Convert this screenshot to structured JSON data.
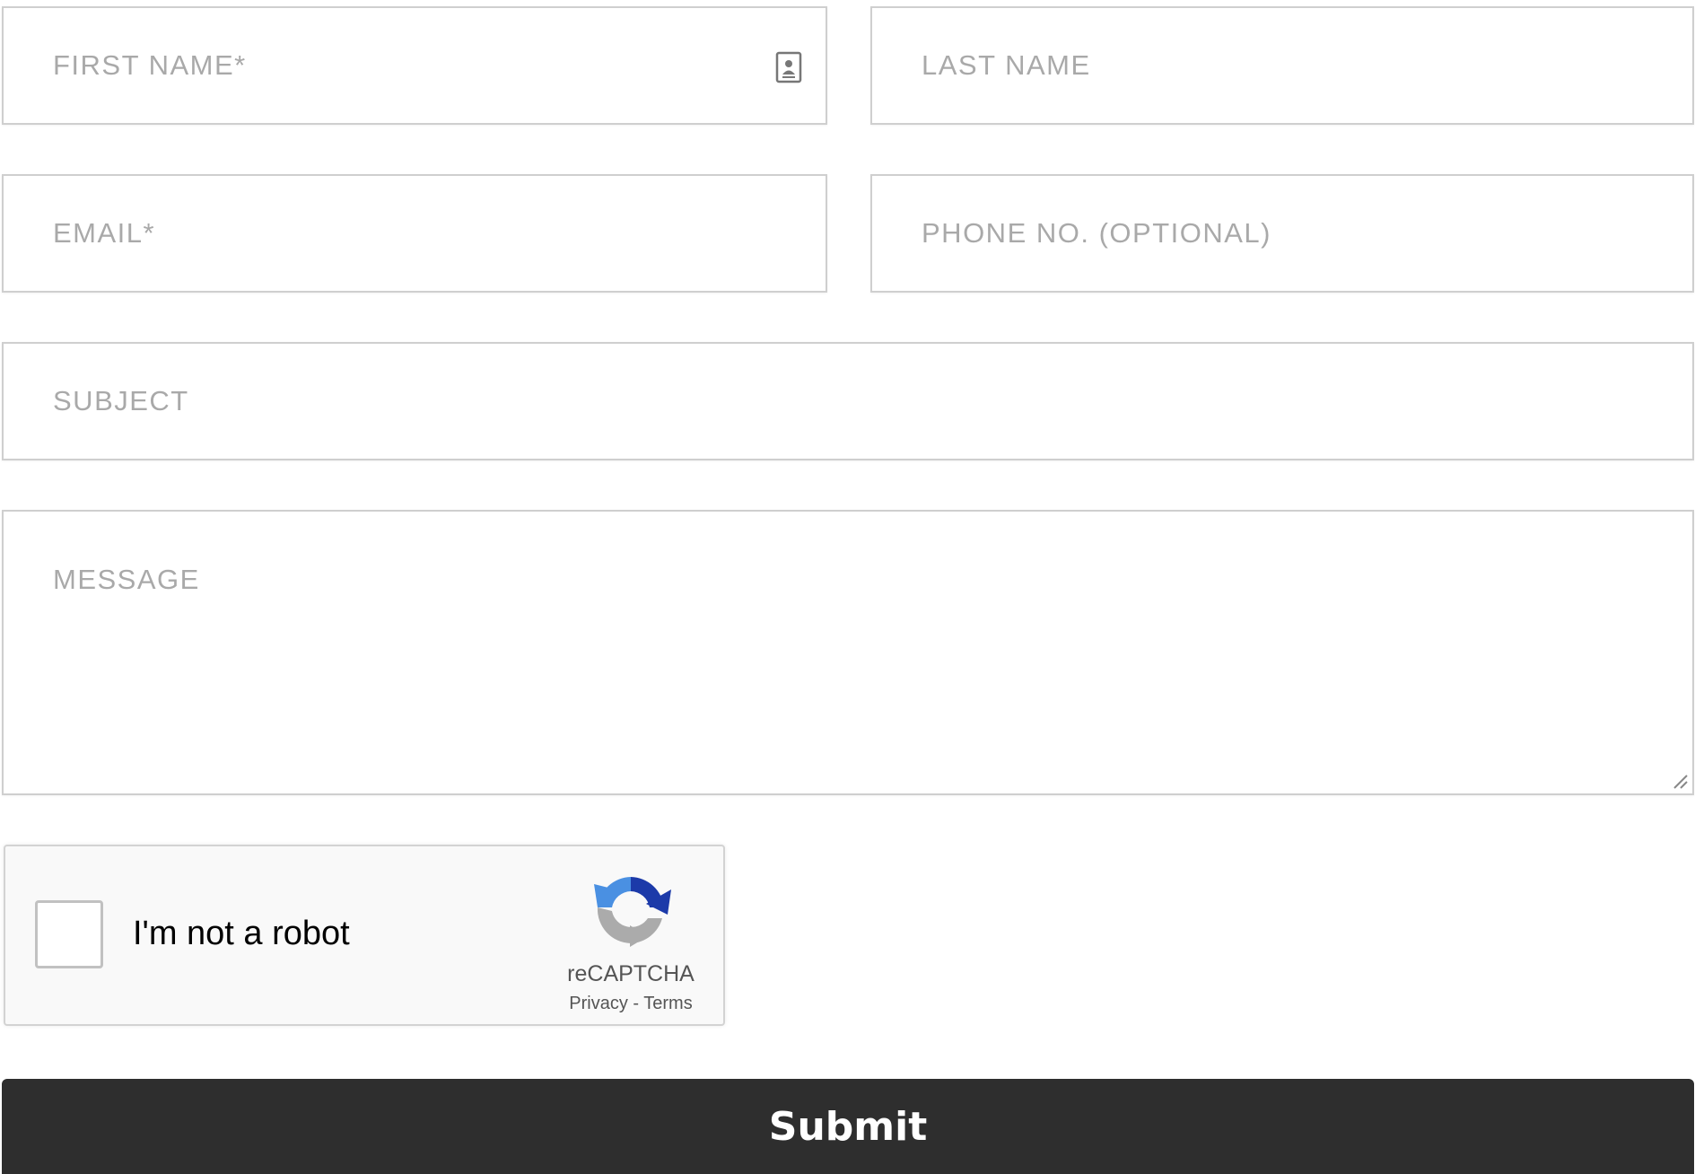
{
  "form": {
    "first_name": {
      "placeholder": "FIRST NAME*",
      "value": ""
    },
    "last_name": {
      "placeholder": "LAST NAME",
      "value": ""
    },
    "email": {
      "placeholder": "EMAIL*",
      "value": ""
    },
    "phone": {
      "placeholder": "PHONE NO. (OPTIONAL)",
      "value": ""
    },
    "subject": {
      "placeholder": "SUBJECT",
      "value": ""
    },
    "message": {
      "placeholder": "MESSAGE",
      "value": ""
    },
    "autofill_icon": "contact-card-icon"
  },
  "recaptcha": {
    "label": "I'm not a robot",
    "checked": false,
    "brand": "reCAPTCHA",
    "privacy": "Privacy",
    "separator": " - ",
    "terms": "Terms"
  },
  "submit": {
    "label": "Submit"
  },
  "colors": {
    "button_bg": "#2e2e2e",
    "button_text": "#ffffff",
    "field_border": "#cfcfcf",
    "placeholder": "#a9a9a9",
    "recaptcha_blue": "#1c3aa9",
    "recaptcha_lightblue": "#4a90e2",
    "recaptcha_gray": "#ababab"
  }
}
